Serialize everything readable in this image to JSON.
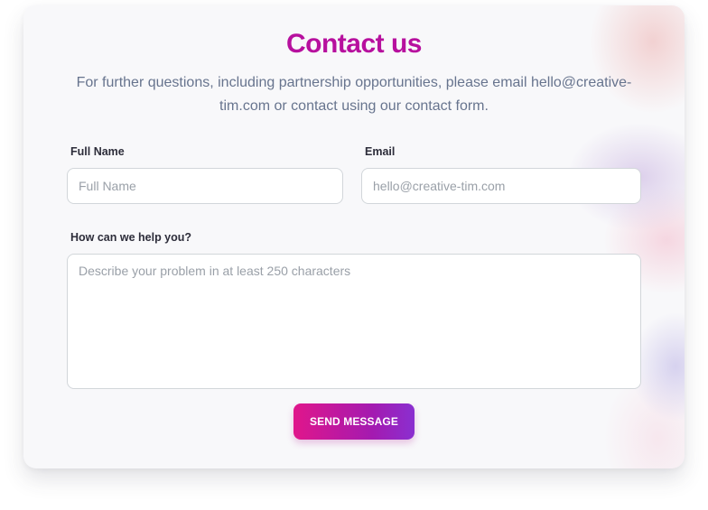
{
  "header": {
    "title": "Contact us",
    "subtitle": "For further questions, including partnership opportunities, please email hello@creative-tim.com or contact using our contact form."
  },
  "form": {
    "full_name": {
      "label": "Full Name",
      "placeholder": "Full Name",
      "value": ""
    },
    "email": {
      "label": "Email",
      "placeholder": "hello@creative-tim.com",
      "value": ""
    },
    "message": {
      "label": "How can we help you?",
      "placeholder": "Describe your problem in at least 250 characters",
      "value": ""
    },
    "submit_label": "SEND MESSAGE"
  },
  "colors": {
    "title": "#b7109e",
    "subtitle": "#67748e",
    "button_gradient_start": "#e0168b",
    "button_gradient_end": "#8a2fd0"
  }
}
